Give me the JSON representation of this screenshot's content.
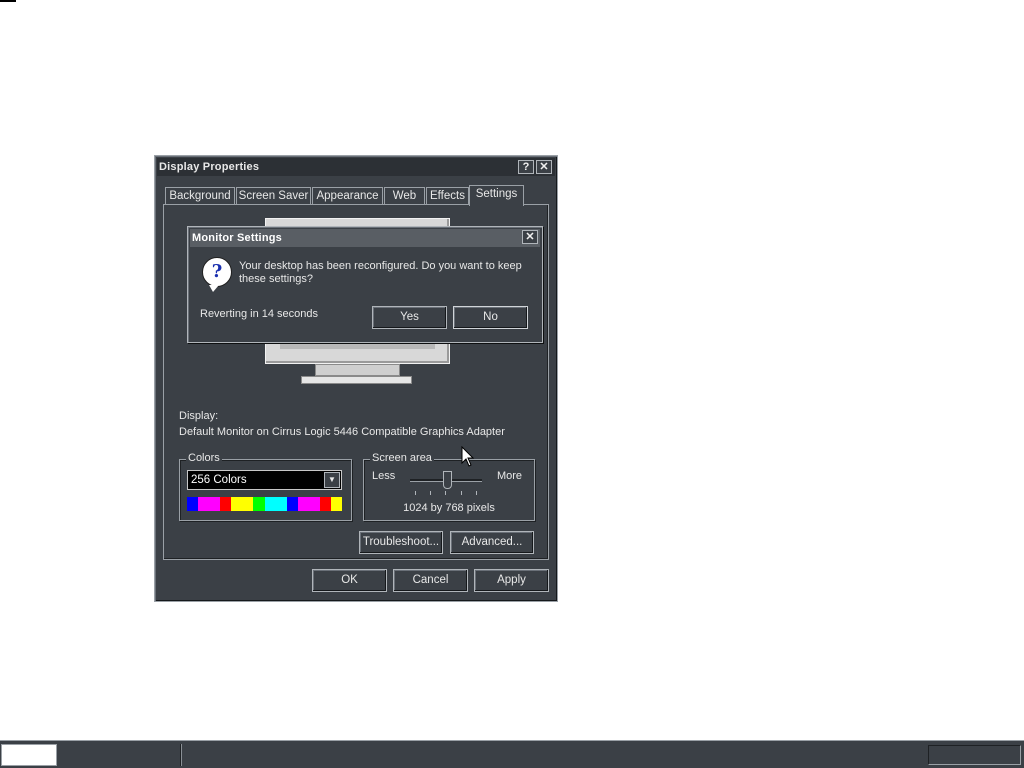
{
  "window": {
    "title": "Display Properties",
    "help_button": "?",
    "close_button": "✕"
  },
  "tabs": [
    "Background",
    "Screen Saver",
    "Appearance",
    "Web",
    "Effects",
    "Settings"
  ],
  "active_tab": "Settings",
  "display": {
    "label": "Display:",
    "value": "Default Monitor on Cirrus Logic 5446 Compatible Graphics Adapter"
  },
  "colors": {
    "legend": "Colors",
    "selected": "256 Colors",
    "palette": [
      "#0000ff",
      "#ff00ff",
      "#ff00ff",
      "#ff0000",
      "#ffff00",
      "#ffff00",
      "#00ff00",
      "#00ffff",
      "#00ffff",
      "#0000ff",
      "#ff00ff",
      "#ff00ff",
      "#ff0000",
      "#ffff00"
    ]
  },
  "screen_area": {
    "legend": "Screen area",
    "less": "Less",
    "more": "More",
    "value": "1024 by 768 pixels"
  },
  "buttons": {
    "troubleshoot": "Troubleshoot...",
    "advanced": "Advanced...",
    "ok": "OK",
    "cancel": "Cancel",
    "apply": "Apply"
  },
  "dialog": {
    "title": "Monitor Settings",
    "close_button": "✕",
    "icon": "question-icon",
    "message": "Your desktop has been reconfigured.  Do you want to keep these settings?",
    "revert_text": "Reverting in 14 seconds",
    "yes": "Yes",
    "no": "No"
  }
}
